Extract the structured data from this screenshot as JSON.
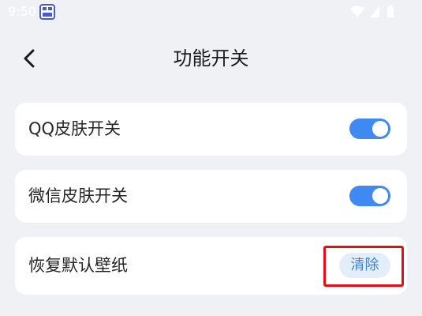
{
  "status_bar": {
    "time": "9:50",
    "icons": [
      "notification-app-icon",
      "wifi-icon",
      "cellular-signal-icon",
      "battery-icon"
    ]
  },
  "header": {
    "back_icon": "chevron-left-icon",
    "title": "功能开关"
  },
  "settings": [
    {
      "label": "QQ皮肤开关",
      "control": "toggle",
      "state": "on"
    },
    {
      "label": "微信皮肤开关",
      "control": "toggle",
      "state": "on"
    },
    {
      "label": "恢复默认壁纸",
      "control": "button",
      "button_label": "清除"
    }
  ],
  "colors": {
    "background": "#f0f1f5",
    "card": "#ffffff",
    "accent": "#3f8af2",
    "clear_button_bg": "#e4eefb",
    "clear_button_text": "#3a82e0",
    "highlight_border": "#e01010"
  }
}
